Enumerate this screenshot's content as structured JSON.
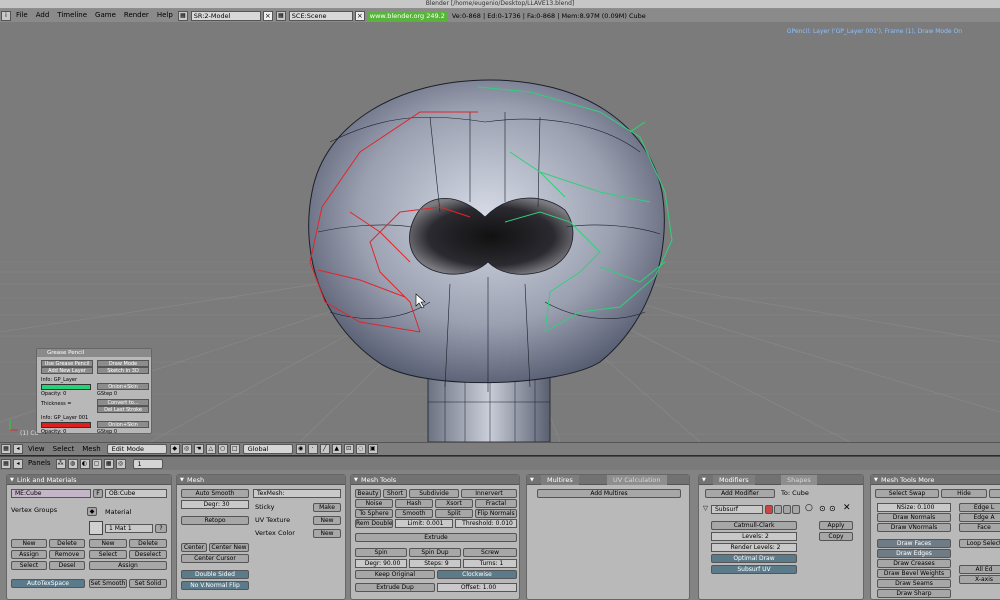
{
  "window_title": "Blender [/home/eugenio/Desktop/LLAVE13.blend]",
  "menu": [
    "File",
    "Add",
    "Timeline",
    "Game",
    "Render",
    "Help"
  ],
  "screen_field": "SR:2-Model",
  "scene_field": "SCE:Scene",
  "url": "www.blender.org 249.2",
  "stats": "Ve:0-868 | Ed:0-1736 | Fa:0-868 | Mem:8.97M (0.09M) Cube",
  "viewport": {
    "gp_info": "GPencil: Layer ('GP_Layer 001'), Frame (1), Draw Mode On",
    "axis_label": "(1) Cu"
  },
  "grease_pencil": {
    "title": "Grease Pencil",
    "use_btn": "Use Grease Pencil",
    "draw_mode": "Draw Mode",
    "add_layer": "Add New Layer",
    "sketch": "Sketch in 3D",
    "layer1": "Info: GP_Layer",
    "onion": "Onion+Skin",
    "opacity": "Opacity: 0",
    "gstep": "GStep 0",
    "thickness": "Thickness =",
    "convert": "Convert to...",
    "del_last": "Del Last Stroke",
    "layer2": "Info: GP_Layer 001",
    "onion2": "Onion+Skin",
    "opacity2": "Opacity: 0",
    "gstep2": "GStep 0",
    "color1": "#27d17c",
    "color2": "#e01e1e"
  },
  "header3d": {
    "view": "View",
    "select": "Select",
    "mesh": "Mesh",
    "mode": "Edit Mode",
    "orientation": "Global"
  },
  "btnheader": {
    "panels": "Panels",
    "frame": "1"
  },
  "link_materials": {
    "title": "Link and Materials",
    "me": "ME:Cube",
    "f": "F",
    "ob": "OB:Cube",
    "vertex_groups": "Vertex Groups",
    "material": "Material",
    "mat": "1 Mat 1",
    "q": "?",
    "new": "New",
    "delete": "Delete",
    "assign": "Assign",
    "remove": "Remove",
    "select": "Select",
    "deselect": "Deselect",
    "desel": "Desel",
    "new2": "New",
    "delete2": "Delete",
    "select2": "Select",
    "assign2": "Assign",
    "autotexspace": "AutoTexSpace",
    "set_smooth": "Set Smooth",
    "set_solid": "Set Solid"
  },
  "mesh": {
    "title": "Mesh",
    "auto_smooth": "Auto Smooth",
    "degr": "Degr: 30",
    "retopo": "Retopo",
    "texmesh": "TexMesh:",
    "sticky": "Sticky",
    "make": "Make",
    "uv_texture": "UV Texture",
    "new": "New",
    "vertex_color": "Vertex Color",
    "new2": "New",
    "center": "Center",
    "center_new": "Center New",
    "center_cursor": "Center Cursor",
    "double_sided": "Double Sided",
    "no_vnormal_flip": "No V.Normal Flip"
  },
  "mesh_tools": {
    "title": "Mesh Tools",
    "beauty": "Beauty",
    "short": "Short",
    "subdivide": "Subdivide",
    "innervert": "Innervert",
    "noise": "Noise",
    "hash": "Hash",
    "xsort": "Xsort",
    "fractal": "Fractal",
    "to_sphere": "To Sphere",
    "smooth": "Smooth",
    "split": "Split",
    "flip_normals": "Flip Normals",
    "rem_double": "Rem Double",
    "limit": "Limit: 0.001",
    "threshold": "Threshold: 0.010",
    "extrude": "Extrude",
    "spin": "Spin",
    "spin_dup": "Spin Dup",
    "screw": "Screw",
    "degr": "Degr: 90.00",
    "steps": "Steps: 9",
    "turns": "Turns: 1",
    "keep_original": "Keep Original",
    "clockwise": "Clockwise",
    "extrude_dup": "Extrude Dup",
    "offset": "Offset: 1.00"
  },
  "multires": {
    "tab1": "Multires",
    "tab2": "UV Calculation",
    "add": "Add Multires"
  },
  "modifiers": {
    "tab1": "Modifiers",
    "tab2": "Shapes",
    "add": "Add Modifier",
    "to": "To: Cube",
    "name": "Subsurf",
    "type": "Catmull-Clark",
    "levels": "Levels: 2",
    "render_levels": "Render Levels: 2",
    "optimal": "Optimal Draw",
    "subsurf_uv": "Subsurf UV",
    "apply": "Apply",
    "copy": "Copy"
  },
  "mesh_tools_more": {
    "title": "Mesh Tools More",
    "select_swap": "Select Swap",
    "hide": "Hide",
    "nsize": "NSize: 0.100",
    "draw_normals": "Draw Normals",
    "draw_vnormals": "Draw VNormals",
    "edge_l": "Edge L",
    "edge_a": "Edge A",
    "face": "Face",
    "draw_faces": "Draw Faces",
    "draw_edges": "Draw Edges",
    "draw_creases": "Draw Creases",
    "draw_bevel": "Draw Bevel Weights",
    "draw_seams": "Draw Seams",
    "draw_sharp": "Draw Sharp",
    "loop_select": "Loop Select",
    "all_ed": "All Ed",
    "x_axis": "X-axis"
  }
}
